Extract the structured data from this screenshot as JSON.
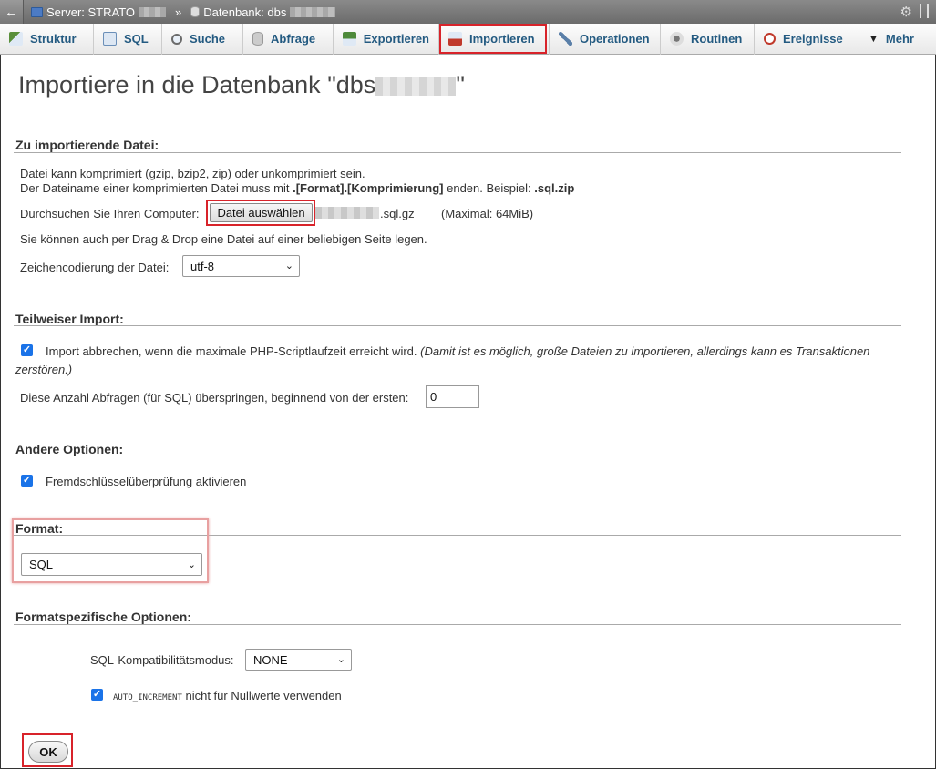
{
  "topbar": {
    "server_label": "Server: STRATO",
    "separator": "»",
    "database_label": "Datenbank: dbs"
  },
  "tabs": [
    {
      "label": "Struktur",
      "icon": "structure-icon"
    },
    {
      "label": "SQL",
      "icon": "sql-icon"
    },
    {
      "label": "Suche",
      "icon": "search-icon"
    },
    {
      "label": "Abfrage",
      "icon": "query-icon"
    },
    {
      "label": "Exportieren",
      "icon": "export-icon"
    },
    {
      "label": "Importieren",
      "icon": "import-icon"
    },
    {
      "label": "Operationen",
      "icon": "wrench-icon"
    },
    {
      "label": "Routinen",
      "icon": "routines-icon"
    },
    {
      "label": "Ereignisse",
      "icon": "clock-icon"
    },
    {
      "label": "Mehr",
      "icon": "triangle-down-icon"
    }
  ],
  "page": {
    "title_prefix": "Importiere in die Datenbank \"dbs",
    "title_suffix": "\""
  },
  "file_section": {
    "title": "Zu importierende Datei:",
    "line1": "Datei kann komprimiert (gzip, bzip2, zip) oder unkomprimiert sein.",
    "line2_a": "Der Dateiname einer komprimierten Datei muss mit ",
    "line2_b": ".[Format].[Komprimierung]",
    "line2_c": " enden. Beispiel: ",
    "line2_d": ".sql.zip",
    "browse_label": "Durchsuchen Sie Ihren Computer:",
    "choose_file_button": "Datei auswählen",
    "file_name_suffix": ".sql.gz",
    "max_size": "(Maximal: 64MiB)",
    "drag_drop_hint": "Sie können auch per Drag & Drop eine Datei auf einer beliebigen Seite legen.",
    "encoding_label": "Zeichencodierung der Datei:",
    "encoding_value": "utf-8"
  },
  "partial_section": {
    "title": "Teilweiser Import:",
    "abort_label": "Import abbrechen, wenn die maximale PHP-Scriptlaufzeit erreicht wird.",
    "abort_note_1": "(Damit ist es möglich, große Dateien zu importieren, allerdings kann es Transaktionen",
    "abort_note_2": "zerstören.)",
    "skip_label": "Diese Anzahl Abfragen (für SQL) überspringen, beginnend von der ersten:",
    "skip_value": "0"
  },
  "other_section": {
    "title": "Andere Optionen:",
    "fk_label": "Fremdschlüsselüberprüfung aktivieren"
  },
  "format_section": {
    "title": "Format:",
    "format_value": "SQL"
  },
  "format_options": {
    "title": "Formatspezifische Optionen:",
    "compat_label": "SQL-Kompatibilitätsmodus:",
    "compat_value": "NONE",
    "auto_inc_code": "AUTO_INCREMENT",
    "auto_inc_label": " nicht für Nullwerte verwenden"
  },
  "ok_button": "OK",
  "colors": {
    "highlight": "#d8232a",
    "tab_text": "#235a81",
    "checkbox": "#1a73e8"
  }
}
